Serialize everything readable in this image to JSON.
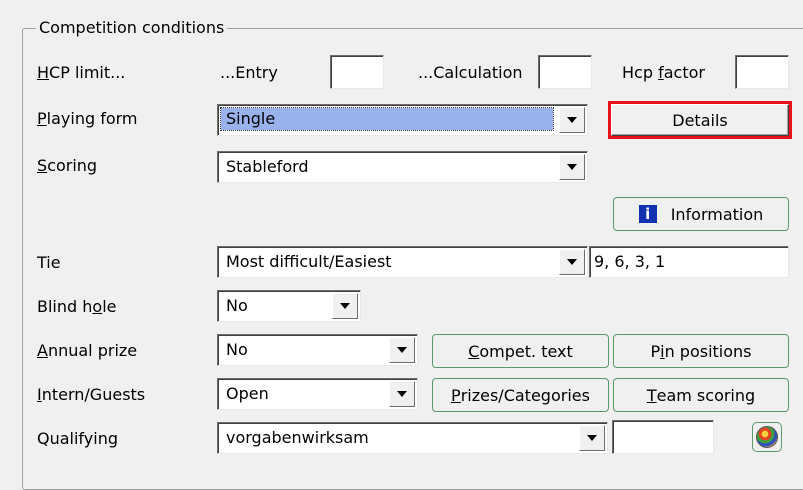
{
  "group": {
    "title": "Competition conditions"
  },
  "hcp": {
    "label_prefix": "H",
    "label_rest": "CP limit...",
    "entry_label": "...Entry",
    "entry_value": "",
    "calc_label": "...Calculation",
    "calc_value": "",
    "factor_label_a": "Hcp ",
    "factor_label_u": "f",
    "factor_label_b": "actor",
    "factor_value": ""
  },
  "playing_form": {
    "label_u": "P",
    "label_rest": "laying form",
    "value": "Single",
    "details_label": "Details"
  },
  "scoring": {
    "label_u": "S",
    "label_rest": "coring",
    "value": "Stableford"
  },
  "information": {
    "label": "Information",
    "icon": "info-icon"
  },
  "tie": {
    "label": "Tie",
    "value": "Most difficult/Easiest",
    "holes": "9, 6, 3, 1"
  },
  "blind_hole": {
    "label_a": "Blind h",
    "label_u": "o",
    "label_b": "le",
    "value": "No"
  },
  "annual_prize": {
    "label_u": "A",
    "label_rest": "nnual prize",
    "value": "No",
    "compet_u": "C",
    "compet_rest": "ompet. text",
    "pin_a": "P",
    "pin_u": "i",
    "pin_b": "n positions"
  },
  "intern": {
    "label_u": "I",
    "label_rest": "ntern/Guests",
    "value": "Open",
    "prizes_u": "P",
    "prizes_rest": "rizes/Categories",
    "team_u": "T",
    "team_rest": "eam scoring"
  },
  "qualifying": {
    "label": "Qualifying",
    "value": "vorgabenwirksam",
    "extra": "",
    "icon": "palette-icon"
  }
}
